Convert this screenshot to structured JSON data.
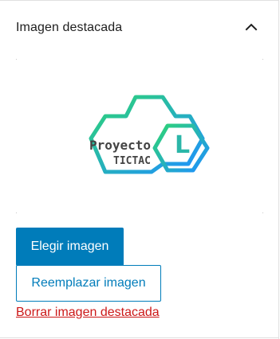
{
  "panel": {
    "title": "Imagen destacada",
    "toggle_icon": "chevron-up-icon"
  },
  "image": {
    "logo_text_line1": "Proyecto",
    "logo_text_line2": "TICTAC",
    "logo_letter": "L",
    "colors": {
      "gradient_start": "#2ed573",
      "gradient_end": "#1e90ff",
      "text": "#444444"
    }
  },
  "buttons": {
    "choose_image": "Elegir imagen",
    "replace_image": "Reemplazar imagen"
  },
  "links": {
    "remove_image": "Borrar imagen destacada"
  },
  "colors": {
    "accent": "#007cba",
    "danger": "#cc1818"
  }
}
